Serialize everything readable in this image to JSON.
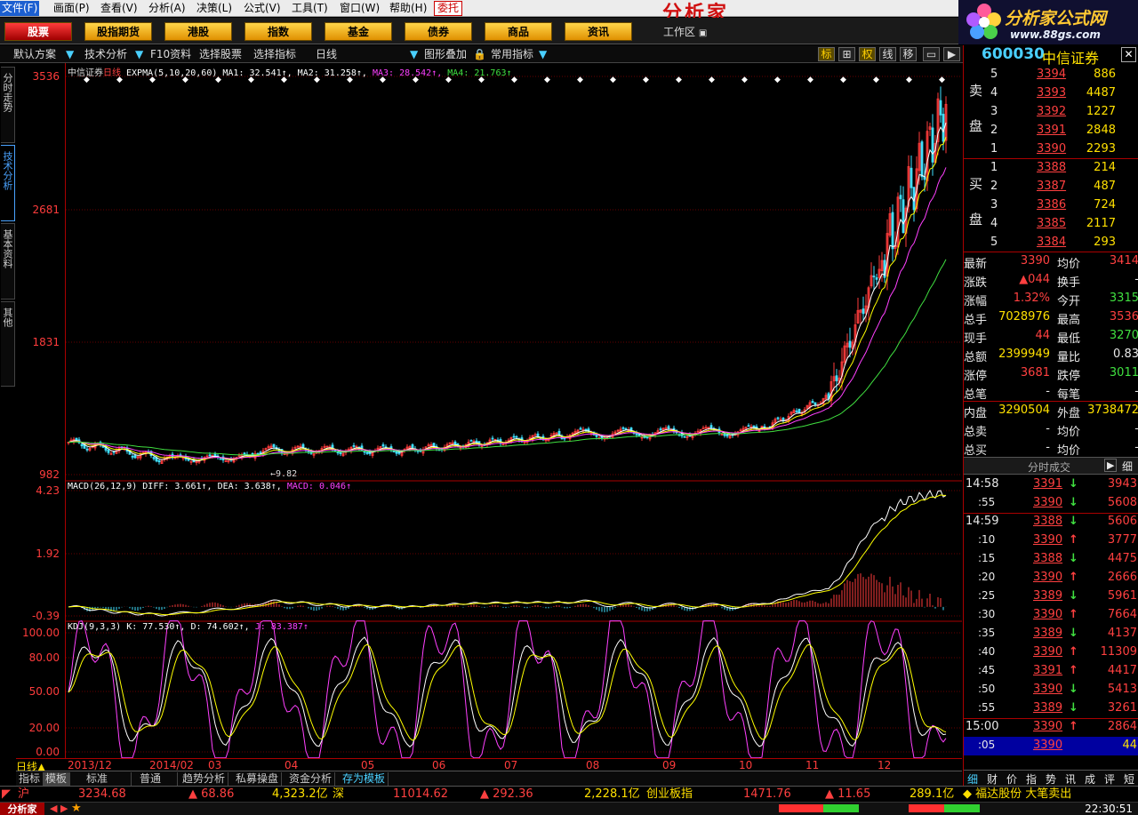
{
  "menubar": {
    "items": [
      "文件(F)",
      "画面(P)",
      "查看(V)",
      "分析(A)",
      "决策(L)",
      "公式(V)",
      "工具(T)",
      "窗口(W)",
      "帮助(H)"
    ],
    "trust": "委托",
    "brand": "分析家"
  },
  "logo": {
    "title": "分析家公式网",
    "url": "www.88gs.com"
  },
  "nav": {
    "buttons": [
      "股票",
      "股指期货",
      "港股",
      "指数",
      "基金",
      "债券",
      "商品",
      "资讯"
    ],
    "workarea": "工作区"
  },
  "toolbar": {
    "items": [
      "默认方案",
      "技术分析",
      "F10资料",
      "选择股票",
      "选择指标",
      "日线",
      "图形叠加",
      "常用指标"
    ],
    "icons": [
      "标",
      "⊞",
      "权",
      "线",
      "移"
    ]
  },
  "sidetabs": [
    "分时走势",
    "技术分析",
    "基本资料",
    "其他"
  ],
  "chart": {
    "main_label": "中信证券日线 EXPMA(5,10,20,60) MA1: 32.541↑, MA2: 31.258↑, MA3: 28.542↑, MA4: 21.763↑",
    "main_prefix": "中信证券",
    "main_period": "日线",
    "ma_text": " EXPMA(5,10,20,60) MA1: 32.541↑, MA2: 31.258↑,",
    "ma3": " MA3: 28.542↑,",
    "ma4": " MA4: 21.763↑",
    "low_note": "9.82",
    "y_main": [
      "3536",
      "2681",
      "1831",
      "982"
    ],
    "macd_label": "MACD(26,12,9) DIFF: 3.661↑, DEA: 3.638↑,",
    "macd_val": " MACD: 0.046↑",
    "y_macd": [
      "4.23",
      "1.92",
      "-0.39"
    ],
    "kdj_label": "KDJ(9,3,3) K: 77.530↑, D: 74.602↑,",
    "kdj_j": " J: 83.387↑",
    "y_kdj": [
      "100.00",
      "80.00",
      "50.00",
      "20.00",
      "0.00"
    ],
    "x_labels": [
      "2013/12",
      "2014/02",
      "03",
      "04",
      "05",
      "06",
      "07",
      "08",
      "09",
      "10",
      "11",
      "12"
    ],
    "period": "日线",
    "colors": {
      "up": "#ff3c3c",
      "down": "#40e0ff",
      "ma1": "#ffffff",
      "ma2": "#ffff00",
      "ma3": "#ff40ff",
      "ma4": "#40e040"
    }
  },
  "bottabs": [
    "指标",
    "模板",
    "标准",
    "普通",
    "趋势分析",
    "私募操盘",
    "资金分析",
    "存为模板"
  ],
  "status": {
    "sh_label": "沪",
    "sh_idx": "3234.68",
    "sh_chg": "▲ 68.86",
    "sh_amt": "4,323.2亿",
    "sz_label": "深",
    "sz_idx": "11014.62",
    "sz_chg": "▲ 292.36",
    "sz_amt": "2,228.1亿",
    "cy_label": "创业板指",
    "cy_idx": "1471.76",
    "cy_chg": "▲ 11.65",
    "cy_amt": "289.1亿",
    "news": "◆ 福达股份 大笔卖出",
    "time": "22:30:51",
    "app": "分析家"
  },
  "quote": {
    "code": "600030",
    "name": "中信证券",
    "sell_label": [
      "卖",
      "盘"
    ],
    "buy_label": [
      "买",
      "盘"
    ],
    "sells": [
      [
        "5",
        "3394",
        "886"
      ],
      [
        "4",
        "3393",
        "4487"
      ],
      [
        "3",
        "3392",
        "1227"
      ],
      [
        "2",
        "3391",
        "2848"
      ],
      [
        "1",
        "3390",
        "2293"
      ]
    ],
    "buys": [
      [
        "1",
        "3388",
        "214"
      ],
      [
        "2",
        "3387",
        "487"
      ],
      [
        "3",
        "3386",
        "724"
      ],
      [
        "4",
        "3385",
        "2117"
      ],
      [
        "5",
        "3384",
        "293"
      ]
    ],
    "stats": [
      [
        "最新",
        "3390",
        "均价",
        "3414"
      ],
      [
        "涨跌",
        "▲044",
        "换手",
        "-"
      ],
      [
        "涨幅",
        "1.32%",
        "今开",
        "3315"
      ],
      [
        "总手",
        "7028976",
        "最高",
        "3536"
      ],
      [
        "现手",
        "44",
        "最低",
        "3270"
      ],
      [
        "总额",
        "2399949",
        "量比",
        "0.83"
      ],
      [
        "涨停",
        "3681",
        "跌停",
        "3011"
      ],
      [
        "总笔",
        "-",
        "每笔",
        "-"
      ],
      [
        "内盘",
        "3290504",
        "外盘",
        "3738472"
      ],
      [
        "总卖",
        "-",
        "均价",
        "-"
      ],
      [
        "总买",
        "-",
        "均价",
        "-"
      ]
    ],
    "ticks_title": "分时成交",
    "ticks_btn": "细",
    "ticks": [
      [
        "14:58",
        "3391",
        "↓",
        "3943"
      ],
      [
        ":55",
        "3390",
        "↓",
        "5608"
      ],
      [
        "14:59",
        "3388",
        "↓",
        "5606"
      ],
      [
        ":10",
        "3390",
        "↑",
        "3777"
      ],
      [
        ":15",
        "3388",
        "↓",
        "4475"
      ],
      [
        ":20",
        "3390",
        "↑",
        "2666"
      ],
      [
        ":25",
        "3389",
        "↓",
        "5961"
      ],
      [
        ":30",
        "3390",
        "↑",
        "7664"
      ],
      [
        ":35",
        "3389",
        "↓",
        "4137"
      ],
      [
        ":40",
        "3390",
        "↑",
        "11309"
      ],
      [
        ":45",
        "3391",
        "↑",
        "4417"
      ],
      [
        ":50",
        "3390",
        "↓",
        "5413"
      ],
      [
        ":55",
        "3389",
        "↓",
        "3261"
      ],
      [
        "15:00",
        "3390",
        "↑",
        "2864"
      ],
      [
        ":05",
        "3390",
        "",
        "44"
      ]
    ],
    "tabs": [
      "细",
      "财",
      "价",
      "指",
      "势",
      "讯",
      "成",
      "评",
      "短"
    ]
  }
}
